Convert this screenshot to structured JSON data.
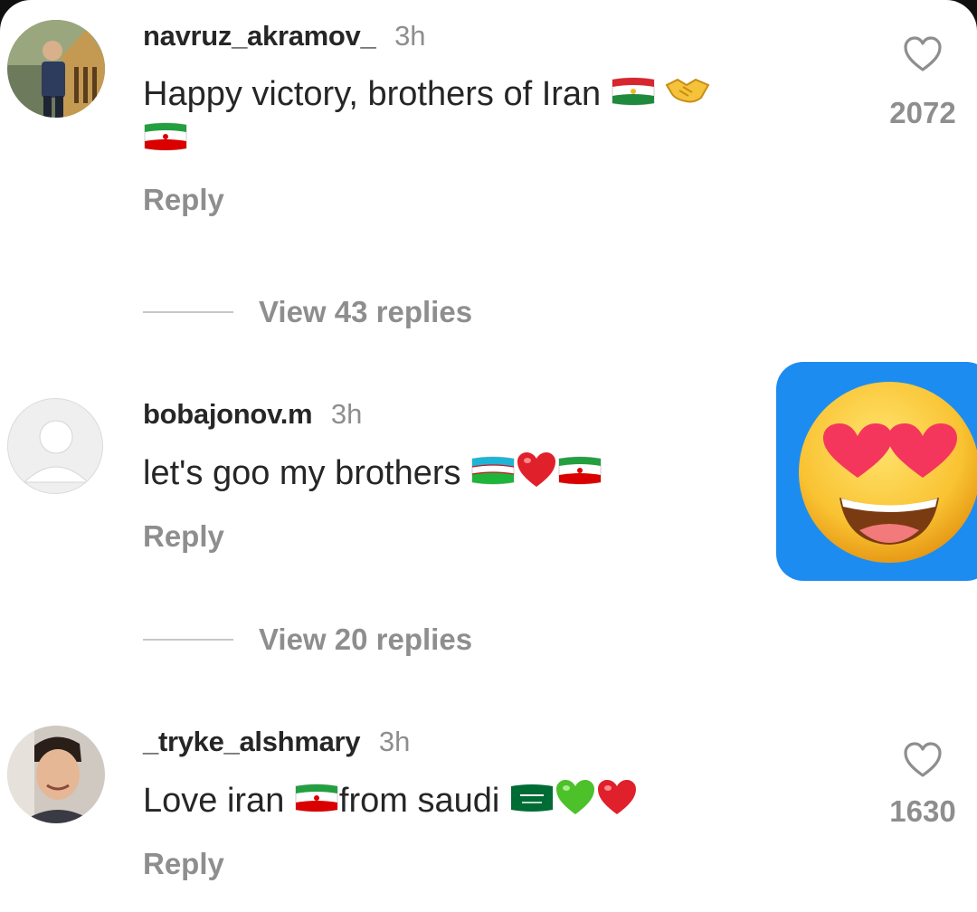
{
  "comments": [
    {
      "username": "navruz_akramov_",
      "time": "3h",
      "text": "Happy victory, brothers of Iran",
      "emojis": [
        "tajikistan-flag",
        "handshake",
        "iran-flag"
      ],
      "reply_label": "Reply",
      "like_count": "2072",
      "view_replies": "View 43 replies"
    },
    {
      "username": "bobajonov.m",
      "time": "3h",
      "text": "let's goo my brothers",
      "emojis": [
        "uzbekistan-flag",
        "red-heart",
        "iran-flag"
      ],
      "reply_label": "Reply",
      "view_replies": "View 20 replies",
      "sticker": "heart-eyes-emoji"
    },
    {
      "username": "_tryke_alshmary",
      "time": "3h",
      "text_part1": "Love iran",
      "text_part2": "from saudi",
      "emojis": [
        "iran-flag",
        "saudi-flag",
        "green-heart",
        "red-heart"
      ],
      "reply_label": "Reply",
      "like_count": "1630"
    }
  ],
  "colors": {
    "text": "#262626",
    "secondary": "#8e8e8e",
    "sticker_bg": "#1d8cf0"
  }
}
